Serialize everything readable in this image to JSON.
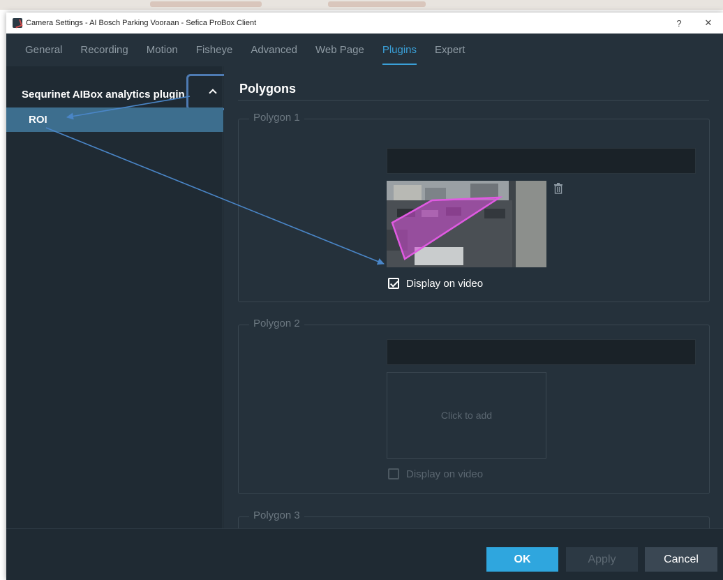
{
  "window": {
    "title": "Camera Settings - AI Bosch Parking Vooraan - Sefica ProBox Client",
    "help_label": "?",
    "close_label": "✕"
  },
  "tabs": [
    {
      "label": "General",
      "active": false
    },
    {
      "label": "Recording",
      "active": false
    },
    {
      "label": "Motion",
      "active": false
    },
    {
      "label": "Fisheye",
      "active": false
    },
    {
      "label": "Advanced",
      "active": false
    },
    {
      "label": "Web Page",
      "active": false
    },
    {
      "label": "Plugins",
      "active": true
    },
    {
      "label": "Expert",
      "active": false
    }
  ],
  "sidebar": {
    "plugin_label": "Sequrinet AIBox analytics plugin",
    "items": [
      {
        "label": "ROI",
        "selected": true
      }
    ]
  },
  "main": {
    "section_title": "Polygons",
    "polygons": [
      {
        "label": "Polygon 1",
        "name_value": "",
        "has_image": true,
        "display_on_video": true,
        "display_label": "Display on video"
      },
      {
        "label": "Polygon 2",
        "name_value": "",
        "has_image": false,
        "add_label": "Click to add",
        "display_on_video": false,
        "display_label": "Display on video"
      },
      {
        "label": "Polygon 3",
        "name_value": ""
      }
    ]
  },
  "footer": {
    "ok_label": "OK",
    "apply_label": "Apply",
    "cancel_label": "Cancel"
  },
  "colors": {
    "accent": "#3aa0d8",
    "ok_button": "#2fa6de",
    "selected_item": "#3d6e8e",
    "polygon_overlay": "#d64fd8",
    "annotation_arrow": "#4a86c8"
  }
}
